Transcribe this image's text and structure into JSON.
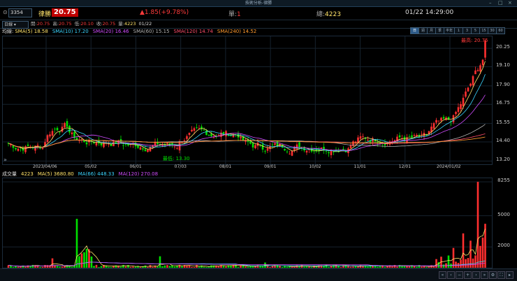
{
  "window": {
    "title": "技術分析-律勝"
  },
  "header": {
    "code": "3354",
    "name": "律勝",
    "price": "20.75",
    "change": "▲1.85(+9.78%)",
    "single_label": "單:",
    "single_value": "1",
    "total_label": "總:",
    "total_value": "4223",
    "datetime": "01/22 14:29:00"
  },
  "toolbar": {
    "period": "日線",
    "ohlc": [
      {
        "label": "開:",
        "value": "20.75"
      },
      {
        "label": "高:",
        "value": "20.75"
      },
      {
        "label": "低:",
        "value": "20.10"
      },
      {
        "label": "收:",
        "value": "20.75"
      },
      {
        "label": "量:",
        "value": "4223"
      },
      {
        "label": "",
        "value": "01/22"
      }
    ],
    "tabs": [
      "日",
      "週",
      "月",
      "季",
      "半年",
      "1",
      "3",
      "5",
      "15",
      "30",
      "60"
    ],
    "selected_tab": "日"
  },
  "ma_legend": {
    "label": "均線:",
    "items": [
      {
        "text": "SMA(5) 18.58",
        "color": "#ffe36a"
      },
      {
        "text": "SMA(10) 17.20",
        "color": "#3ad4ff"
      },
      {
        "text": "SMA(20) 16.46",
        "color": "#d04cff"
      },
      {
        "text": "SMA(60) 15.15",
        "color": "#b0b0b0"
      },
      {
        "text": "SMA(120) 14.74",
        "color": "#ff4d6a"
      },
      {
        "text": "SMA(240) 14.52",
        "color": "#ff9a2e"
      }
    ]
  },
  "volume_legend": {
    "label": "成交量",
    "items": [
      {
        "text": "4223",
        "color": "#ffe36a"
      },
      {
        "text": "MA(5) 3680.80",
        "color": "#ffe36a"
      },
      {
        "text": "MA(66) 448.33",
        "color": "#3ad4ff"
      },
      {
        "text": "MA(120) 270.08",
        "color": "#d04cff"
      }
    ]
  },
  "annotations": {
    "high": "最高: 20.75",
    "low": "最低: 13.30"
  },
  "colors": {
    "up": "#ff2f2f",
    "down": "#00e000",
    "bg": "#000000",
    "grid": "#1c2c3c"
  },
  "chart_data": [
    {
      "type": "candlestick",
      "title": "",
      "y_ticks": [
        "20.25",
        "19.10",
        "17.90",
        "16.75",
        "15.55",
        "14.40",
        "13.20"
      ],
      "ylim": [
        13.0,
        21.0
      ],
      "x_ticks": [
        "2023/04/06",
        "05/02",
        "06/01",
        "07/03",
        "08/01",
        "09/01",
        "10/02",
        "11/01",
        "12/01",
        "2024/01/02"
      ],
      "last_close": 20.75,
      "high": 20.75,
      "low": 13.3
    },
    {
      "type": "bar",
      "title": "",
      "y_ticks": [
        "8255",
        "5000",
        "2000"
      ],
      "ylim": [
        0,
        8600
      ],
      "latest_volume": 4223,
      "peak_volume": 8255
    }
  ]
}
